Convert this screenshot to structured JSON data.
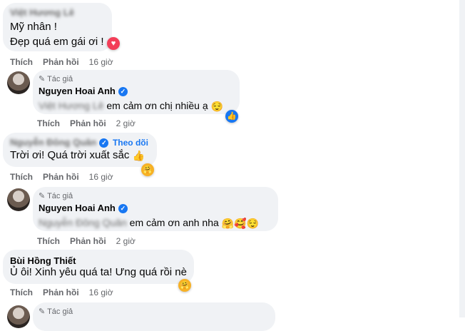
{
  "comments": [
    {
      "name": "Việt Hương Lê",
      "lines": [
        "Mỹ nhân !",
        "Đẹp quá em gái ơi !"
      ],
      "actions": {
        "like": "Thích",
        "reply": "Phản hồi",
        "time": "16 giờ"
      },
      "reaction": "heart"
    },
    {
      "badge": "Tác giả",
      "name": "Nguyen Hoai Anh",
      "mention": "Việt Hương Lê",
      "text": "em cảm ơn chị nhiều ạ",
      "emoji": "relieved-face",
      "actions": {
        "like": "Thích",
        "reply": "Phản hồi",
        "time": "2 giờ"
      },
      "reaction": "like"
    },
    {
      "name": "Nguyễn Đông Quân",
      "follow": "Theo dõi",
      "text": "Trời ơi! Quá trời xuất sắc",
      "emoji": "thumbs-up",
      "actions": {
        "like": "Thích",
        "reply": "Phản hồi",
        "time": "16 giờ"
      },
      "reaction": "care"
    },
    {
      "badge": "Tác giả",
      "name": "Nguyen Hoai Anh",
      "mention": "Nguyễn Đông Quân",
      "text": "em cảm ơn anh nha",
      "emojis": [
        "hugging-face",
        "smiling-face-with-hearts",
        "relieved-face"
      ],
      "actions": {
        "like": "Thích",
        "reply": "Phản hồi",
        "time": "2 giờ"
      }
    },
    {
      "name": "Bùi Hồng Thiết",
      "text": "Ủ ôi! Xinh yêu quá ta! Ưng quá rồi nè",
      "actions": {
        "like": "Thích",
        "reply": "Phản hồi",
        "time": "16 giờ"
      },
      "reaction": "care"
    },
    {
      "badge": "Tác giả"
    }
  ]
}
